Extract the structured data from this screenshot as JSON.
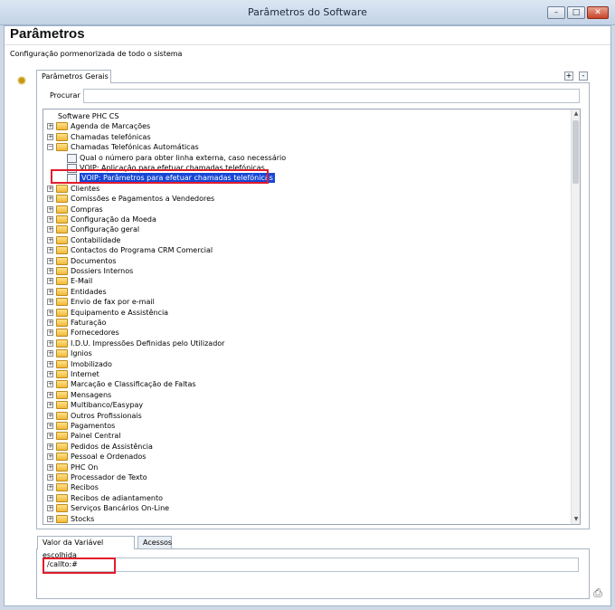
{
  "window": {
    "title": "Parâmetros do Software"
  },
  "header": {
    "title": "Parâmetros",
    "subtitle": "Configuração pormenorizada de todo o sistema"
  },
  "tabs": {
    "main_label": "Parâmetros Gerais"
  },
  "search": {
    "label": "Procurar :",
    "value": ""
  },
  "tree": {
    "rows": [
      {
        "label": "Software PHC CS",
        "type": "root",
        "level": 0
      },
      {
        "label": "Agenda de Marcações",
        "type": "folder",
        "level": 1
      },
      {
        "label": "Chamadas telefónicas",
        "type": "folder",
        "level": 1
      },
      {
        "label": "Chamadas Telefónicas Automáticas",
        "type": "folder-open",
        "level": 1
      },
      {
        "label": "Qual o número para obter linha externa, caso necessário",
        "type": "param",
        "level": 2
      },
      {
        "label": "VOIP: Aplicação para efetuar chamadas telefónicas",
        "type": "param",
        "level": 2
      },
      {
        "label": "VOIP: Parâmetros para efetuar chamadas telefónicas",
        "type": "param",
        "level": 2,
        "selected": true
      },
      {
        "label": "Clientes",
        "type": "folder",
        "level": 1
      },
      {
        "label": "Comissões e Pagamentos a Vendedores",
        "type": "folder",
        "level": 1
      },
      {
        "label": "Compras",
        "type": "folder",
        "level": 1
      },
      {
        "label": "Configuração da Moeda",
        "type": "folder",
        "level": 1
      },
      {
        "label": "Configuração geral",
        "type": "folder",
        "level": 1
      },
      {
        "label": "Contabilidade",
        "type": "folder",
        "level": 1
      },
      {
        "label": "Contactos do Programa CRM Comercial",
        "type": "folder",
        "level": 1
      },
      {
        "label": "Documentos",
        "type": "folder",
        "level": 1
      },
      {
        "label": "Dossiers Internos",
        "type": "folder",
        "level": 1
      },
      {
        "label": "E-Mail",
        "type": "folder",
        "level": 1
      },
      {
        "label": "Entidades",
        "type": "folder",
        "level": 1
      },
      {
        "label": "Envio de fax por e-mail",
        "type": "folder",
        "level": 1
      },
      {
        "label": "Equipamento e Assistência",
        "type": "folder",
        "level": 1
      },
      {
        "label": "Faturação",
        "type": "folder",
        "level": 1
      },
      {
        "label": "Fornecedores",
        "type": "folder",
        "level": 1
      },
      {
        "label": "I.D.U. Impressões Definidas pelo Utilizador",
        "type": "folder",
        "level": 1
      },
      {
        "label": "Ignios",
        "type": "folder",
        "level": 1
      },
      {
        "label": "Imobilizado",
        "type": "folder",
        "level": 1
      },
      {
        "label": "Internet",
        "type": "folder",
        "level": 1
      },
      {
        "label": "Marcação e Classificação de Faltas",
        "type": "folder",
        "level": 1
      },
      {
        "label": "Mensagens",
        "type": "folder",
        "level": 1
      },
      {
        "label": "Multibanco/Easypay",
        "type": "folder",
        "level": 1
      },
      {
        "label": "Outros Profissionais",
        "type": "folder",
        "level": 1
      },
      {
        "label": "Pagamentos",
        "type": "folder",
        "level": 1
      },
      {
        "label": "Painel Central",
        "type": "folder",
        "level": 1
      },
      {
        "label": "Pedidos de Assistência",
        "type": "folder",
        "level": 1
      },
      {
        "label": "Pessoal e Ordenados",
        "type": "folder",
        "level": 1
      },
      {
        "label": "PHC On",
        "type": "folder",
        "level": 1
      },
      {
        "label": "Processador de Texto",
        "type": "folder",
        "level": 1
      },
      {
        "label": "Recibos",
        "type": "folder",
        "level": 1
      },
      {
        "label": "Recibos de adiantamento",
        "type": "folder",
        "level": 1
      },
      {
        "label": "Serviços Bancários On-Line",
        "type": "folder",
        "level": 1
      },
      {
        "label": "Stocks",
        "type": "folder",
        "level": 1
      }
    ]
  },
  "bottom_tabs": {
    "value_label": "Valor da Variável escolhida",
    "access_label": "Acessos"
  },
  "value": {
    "text": "/callto:#"
  },
  "icons": {
    "gear": "gear-icon",
    "printer": "printer-icon",
    "folder": "folder-icon",
    "param": "parameter-icon"
  },
  "colors": {
    "selection": "#1747d6",
    "highlight_box": "#e21c2c"
  }
}
